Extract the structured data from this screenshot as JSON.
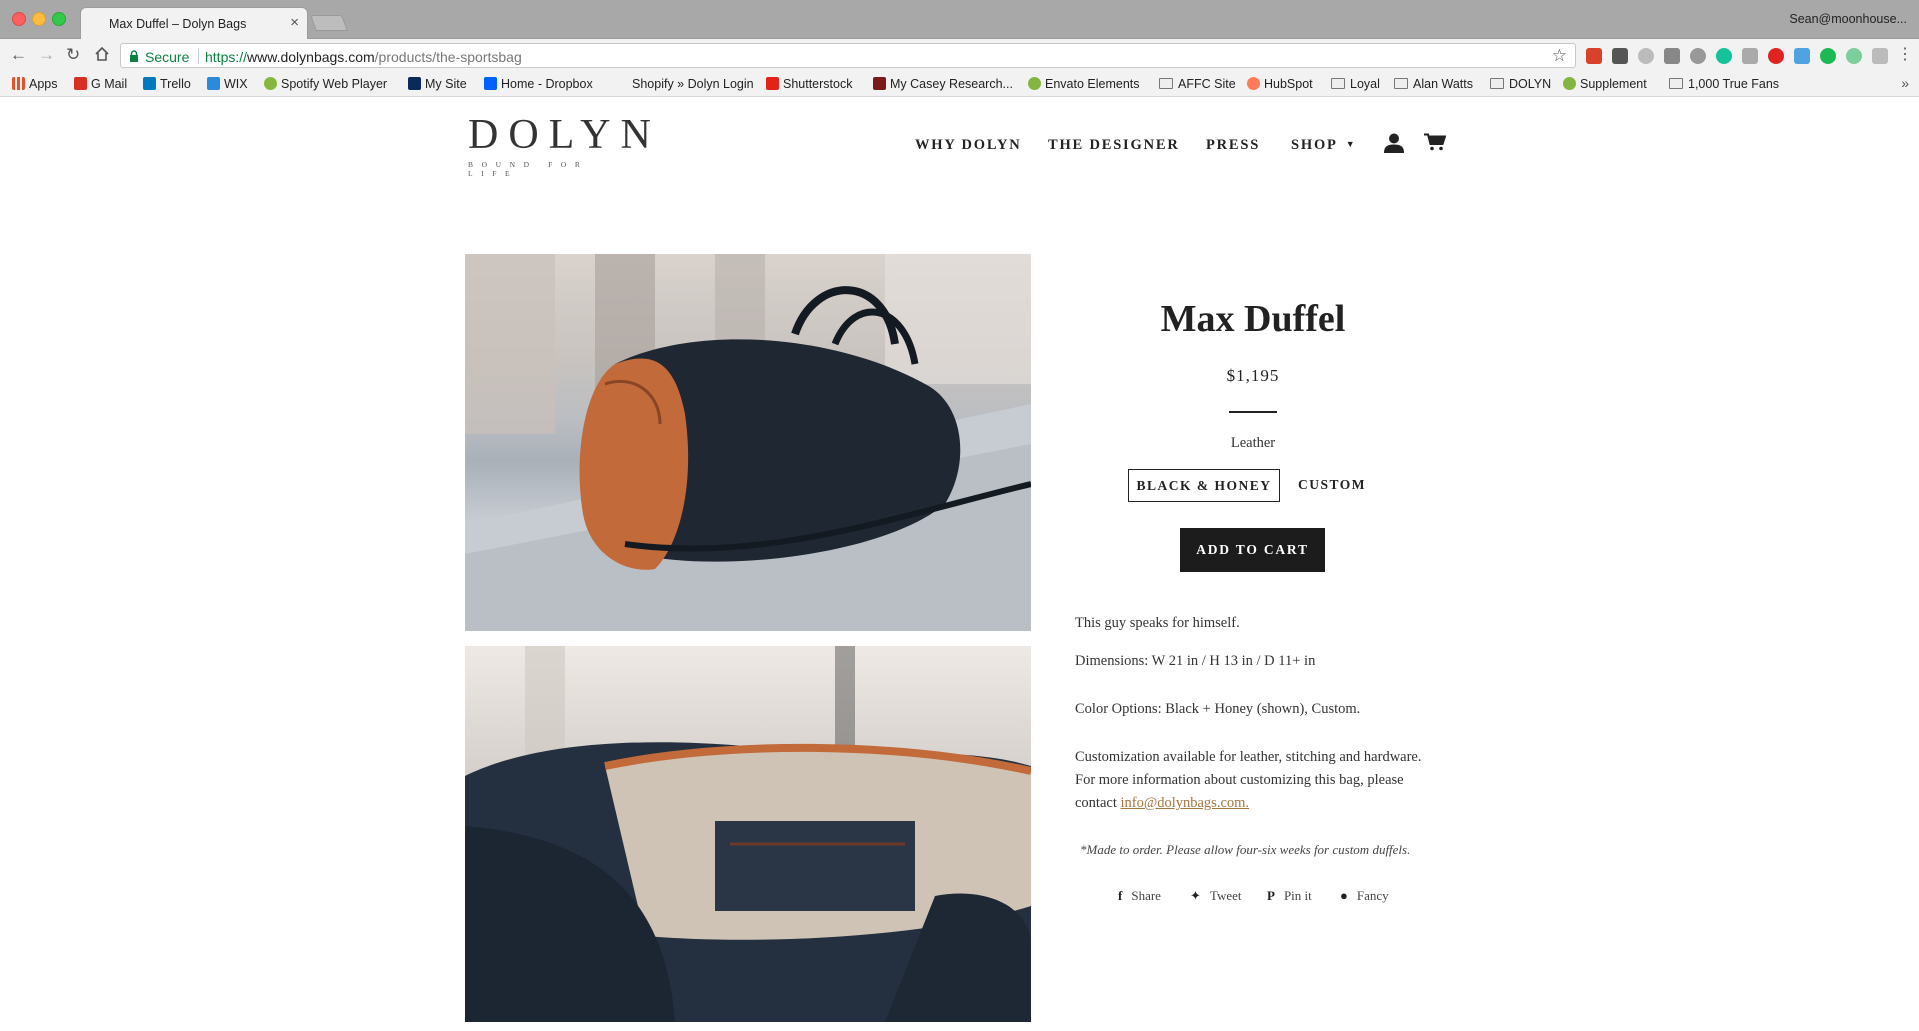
{
  "browser": {
    "tab_title": "Max Duffel – Dolyn Bags",
    "tab_close": "×",
    "profile": "Sean@moonhouse...",
    "secure_label": "Secure",
    "url_protocol": "https://",
    "url_host": "www.dolynbags.com",
    "url_path": "/products/the-sportsbag",
    "bookmarks": [
      {
        "label": "Apps",
        "icon": "apps-grid-icon",
        "color": "#e0552e"
      },
      {
        "label": "G Mail",
        "icon": "gmail-icon",
        "color": "#d93025"
      },
      {
        "label": "Trello",
        "icon": "trello-icon",
        "color": "#0079bf"
      },
      {
        "label": "WIX",
        "icon": "wix-icon",
        "color": "#2b8ad9"
      },
      {
        "label": "Spotify Web Player",
        "icon": "spotify-icon",
        "color": "#85b93e"
      },
      {
        "label": "My Site",
        "icon": "site-icon",
        "color": "#0b2a5a"
      },
      {
        "label": "Home - Dropbox",
        "icon": "dropbox-icon",
        "color": "#0061fe"
      },
      {
        "label": "Shopify » Dolyn Login",
        "icon": "none",
        "color": ""
      },
      {
        "label": "Shutterstock",
        "icon": "shutterstock-icon",
        "color": "#e2231a"
      },
      {
        "label": "My Casey Research...",
        "icon": "casey-icon",
        "color": "#7a1a1a"
      },
      {
        "label": "Envato Elements",
        "icon": "envato-icon",
        "color": "#82b541"
      },
      {
        "label": "AFFC Site",
        "icon": "folder-icon",
        "color": ""
      },
      {
        "label": "HubSpot",
        "icon": "hubspot-icon",
        "color": "#ff7a59"
      },
      {
        "label": "Loyal",
        "icon": "folder-icon",
        "color": ""
      },
      {
        "label": "Alan Watts",
        "icon": "folder-icon",
        "color": ""
      },
      {
        "label": "DOLYN",
        "icon": "folder-icon",
        "color": ""
      },
      {
        "label": "Supplement",
        "icon": "envato-icon",
        "color": "#82b541"
      },
      {
        "label": "1,000 True Fans",
        "icon": "folder-icon",
        "color": ""
      }
    ]
  },
  "store": {
    "logo_word": "DOLYN",
    "logo_tagline": "BOUND FOR LIFE",
    "nav": [
      "WHY DOLYN",
      "THE DESIGNER",
      "PRESS",
      "SHOP"
    ]
  },
  "product": {
    "title": "Max Duffel",
    "price": "$1,195",
    "option_label": "Leather",
    "options": [
      "BLACK & HONEY",
      "CUSTOM"
    ],
    "add_to_cart": "ADD TO CART",
    "desc_1": "This guy speaks for himself.",
    "desc_2": "Dimensions: W 21 in / H 13 in / D 11+ in",
    "desc_3": "Color Options: Black + Honey (shown), Custom.",
    "desc_4a": "Customization available for leather, stitching and hardware.",
    "desc_4b": "For more information about customizing this bag, please",
    "desc_4c": "contact ",
    "email": "info@dolynbags.com.",
    "note": "*Made to order. Please allow four-six weeks for custom duffels.",
    "share": [
      "Share",
      "Tweet",
      "Pin it",
      "Fancy"
    ]
  }
}
